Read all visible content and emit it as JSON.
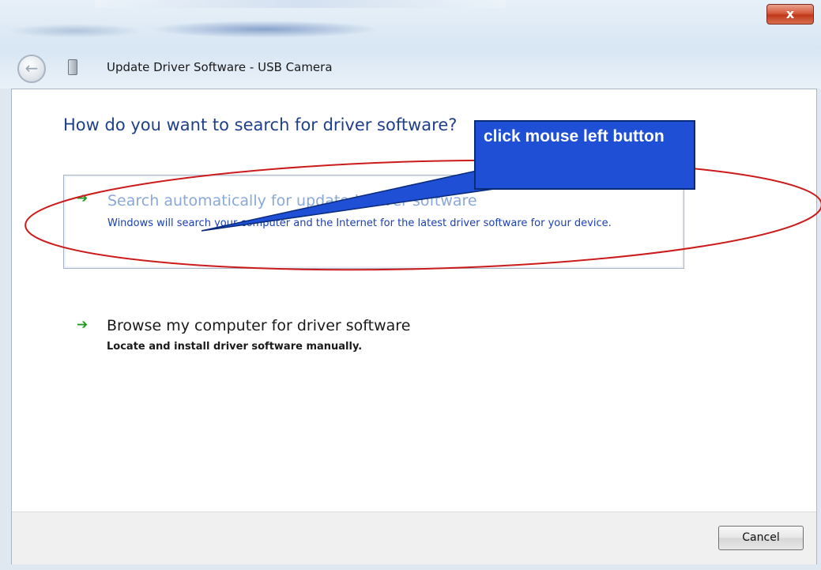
{
  "window": {
    "title": "Update Driver Software - USB Camera",
    "close_label": "x"
  },
  "content": {
    "heading": "How do you want to search for driver software?",
    "options": [
      {
        "title": "Search automatically for updated driver software",
        "description": "Windows will search your computer and the Internet for the latest driver software for your device."
      },
      {
        "title": "Browse my computer for driver software",
        "description": "Locate and install driver software manually."
      }
    ]
  },
  "footer": {
    "cancel_label": "Cancel"
  },
  "annotation": {
    "callout_text": "click mouse left button",
    "highlight_color": "#cc1b1b",
    "callout_color": "#1f4fd4"
  }
}
